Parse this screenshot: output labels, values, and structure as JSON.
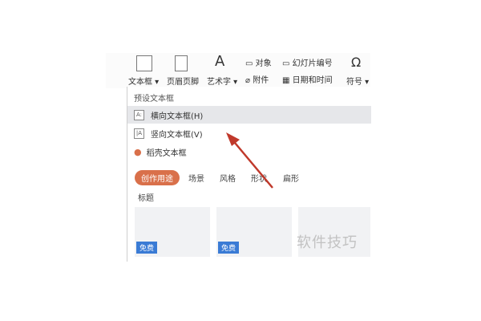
{
  "ribbon": {
    "text_box": "文本框",
    "header_footer": "页眉页脚",
    "word_art": "艺术字",
    "attachment": "附件",
    "date_time": "日期和时间",
    "symbol": "符号",
    "object": "对象",
    "slide_number": "幻灯片编号"
  },
  "dropdown": {
    "preset_label": "预设文本框",
    "items": [
      {
        "label": "横向文本框(H)",
        "icon": "A:"
      },
      {
        "label": "竖向文本框(V)",
        "icon": "|A"
      }
    ],
    "daoke_label": "稻壳文本框",
    "tabs": [
      "创作用途",
      "场景",
      "风格",
      "形状",
      "扁形"
    ],
    "active_tab": 0,
    "subtag": "标题",
    "free_badge": "免费"
  },
  "watermark": "软件技巧"
}
